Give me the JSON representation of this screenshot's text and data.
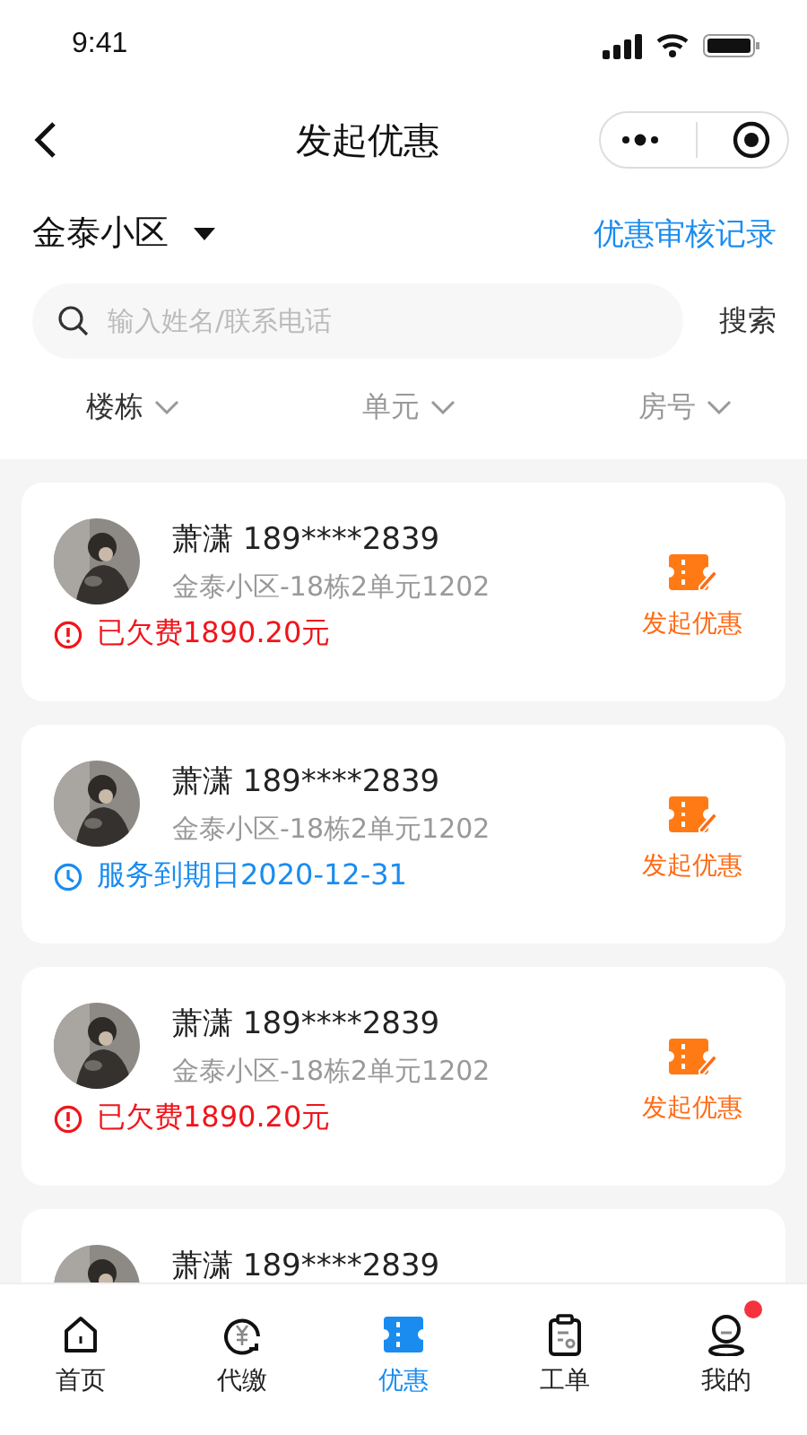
{
  "status_bar": {
    "time": "9:41"
  },
  "nav": {
    "title": "发起优惠"
  },
  "community": {
    "name": "金泰小区",
    "link": "优惠审核记录"
  },
  "search": {
    "placeholder": "输入姓名/联系电话",
    "button": "搜索"
  },
  "filters": [
    {
      "label": "楼栋",
      "active": true
    },
    {
      "label": "单元",
      "active": false
    },
    {
      "label": "房号",
      "active": false
    }
  ],
  "members": [
    {
      "name": "萧潇",
      "phone": "189****2839",
      "address": "金泰小区-18栋2单元1202",
      "status": {
        "kind": "overdue",
        "text": "已欠费1890.20元"
      },
      "action": "发起优惠"
    },
    {
      "name": "萧潇",
      "phone": "189****2839",
      "address": "金泰小区-18栋2单元1202",
      "status": {
        "kind": "expiry",
        "text": "服务到期日2020-12-31"
      },
      "action": "发起优惠"
    },
    {
      "name": "萧潇",
      "phone": "189****2839",
      "address": "金泰小区-18栋2单元1202",
      "status": {
        "kind": "overdue",
        "text": "已欠费1890.20元"
      },
      "action": "发起优惠"
    },
    {
      "name": "萧潇",
      "phone": "189****2839"
    }
  ],
  "tabs": [
    {
      "label": "首页",
      "kind": "home",
      "selected": false,
      "badge": false
    },
    {
      "label": "代缴",
      "kind": "pay",
      "selected": false,
      "badge": false
    },
    {
      "label": "优惠",
      "kind": "ticket",
      "selected": true,
      "badge": false
    },
    {
      "label": "工单",
      "kind": "order",
      "selected": false,
      "badge": false
    },
    {
      "label": "我的",
      "kind": "user",
      "selected": false,
      "badge": true
    }
  ]
}
